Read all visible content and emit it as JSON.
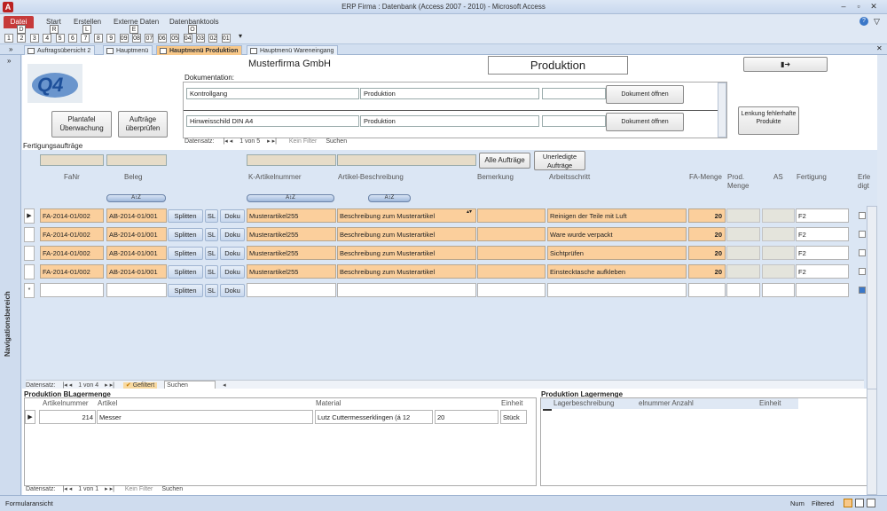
{
  "window": {
    "title": "ERP Firma : Datenbank (Access 2007 - 2010)  -  Microsoft Access"
  },
  "ribbon": {
    "tabs": [
      "Datei",
      "Start",
      "Erstellen",
      "Externe Daten",
      "Datenbanktools"
    ],
    "keytips": [
      "D",
      "R",
      "L",
      "E",
      "O"
    ],
    "quickaccess": [
      "1",
      "2",
      "3",
      "4",
      "5",
      "6",
      "7",
      "8",
      "9",
      "09",
      "08",
      "07",
      "06",
      "05",
      "04",
      "03",
      "02",
      "01"
    ]
  },
  "doctabs": [
    {
      "label": "Auftragsübersicht 2"
    },
    {
      "label": "Hauptmenü"
    },
    {
      "label": "Hauptmenü Produktion"
    },
    {
      "label": "Hauptmenü Wareneingang"
    }
  ],
  "navpane": {
    "label": "Navigationsbereich"
  },
  "header": {
    "company": "Musterfirma GmbH",
    "module": "Produktion",
    "doc_label": "Dokumentation:",
    "btn_plantafel": "Plantafel Überwachung",
    "btn_auftraege": "Aufträge überprüfen",
    "btn_lenkung": "Lenkung fehlerhafte Produkte",
    "docs": [
      {
        "name": "Kontrollgang",
        "area": "Produktion",
        "open": "Dokument öffnen"
      },
      {
        "name": "Hinweisschild DIN A4",
        "area": "Produktion",
        "open": "Dokument öffnen"
      }
    ],
    "docnav": {
      "label": "Datensatz:",
      "pos": "1 von 5",
      "filter": "Kein Filter",
      "search": "Suchen"
    }
  },
  "orders": {
    "section": "Fertigungsaufträge",
    "btn_all": "Alle Aufträge",
    "btn_open": "Unerledigte Aufträge",
    "columns": [
      "FaNr",
      "Beleg",
      "K-Artikelnummer",
      "Artikel-Beschreibung",
      "Bemerkung",
      "Arbeitsschritt",
      "FA-Menge",
      "Prod. Menge",
      "AS",
      "Fertigung",
      "Erle digt"
    ],
    "row_buttons": {
      "split": "Splitten",
      "sl": "SL",
      "doku": "Doku"
    },
    "rows": [
      {
        "fanr": "FA-2014-01/002",
        "beleg": "AB-2014-01/001",
        "artnr": "Musterartikel255",
        "beschr": "Beschreibung zum Musterartikel",
        "bem": "",
        "schritt": "Reinigen der Teile mit Luft",
        "menge": "20",
        "fert": "F2"
      },
      {
        "fanr": "FA-2014-01/002",
        "beleg": "AB-2014-01/001",
        "artnr": "Musterartikel255",
        "beschr": "Beschreibung zum Musterartikel",
        "bem": "",
        "schritt": "Ware wurde verpackt",
        "menge": "20",
        "fert": "F2"
      },
      {
        "fanr": "FA-2014-01/002",
        "beleg": "AB-2014-01/001",
        "artnr": "Musterartikel255",
        "beschr": "Beschreibung zum Musterartikel",
        "bem": "",
        "schritt": "Sichtprüfen",
        "menge": "20",
        "fert": "F2"
      },
      {
        "fanr": "FA-2014-01/002",
        "beleg": "AB-2014-01/001",
        "artnr": "Musterartikel255",
        "beschr": "Beschreibung zum Musterartikel",
        "bem": "",
        "schritt": "Einstecktasche aufkleben",
        "menge": "20",
        "fert": "F2"
      }
    ],
    "nav": {
      "label": "Datensatz:",
      "pos": "1 von 4",
      "filter": "Gefiltert",
      "search": "Suchen"
    }
  },
  "blager": {
    "title": "Produktion BLagermenge",
    "columns": [
      "Artikelnummer",
      "Artikel",
      "Material",
      "Einheit"
    ],
    "row": {
      "nr": "214",
      "artikel": "Messer",
      "material": "Lutz Cuttermesserklingen (á 12",
      "menge": "20",
      "einheit": "Stück"
    },
    "nav": {
      "label": "Datensatz:",
      "pos": "1 von 1",
      "filter": "Kein Filter",
      "search": "Suchen"
    }
  },
  "lager": {
    "title": "Produktion Lagermenge",
    "columns": [
      "Lagerbeschreibung",
      "elnummer Anzahl",
      "Einheit"
    ]
  },
  "status": {
    "left": "Formularansicht",
    "num": "Num",
    "filtered": "Filtered"
  }
}
